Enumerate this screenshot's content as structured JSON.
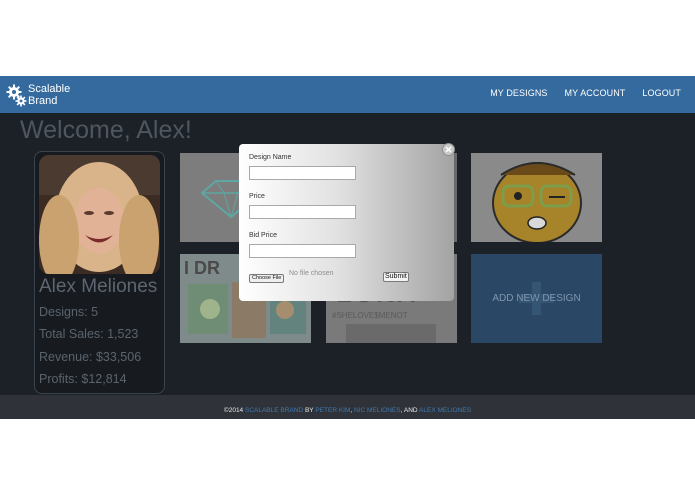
{
  "navbar": {
    "brand_line1": "Scalable",
    "brand_line2": "Brand",
    "links": [
      "MY DESIGNS",
      "MY ACCOUNT",
      "LOGOUT"
    ]
  },
  "main": {
    "welcome": "Welcome, Alex!",
    "profile": {
      "name": "Alex Meliones",
      "designs": "Designs: 5",
      "total_sales": "Total Sales: 1,523",
      "revenue": "Revenue: $33,506",
      "profits": "Profits: $12,814"
    },
    "add_new_design": "ADD NEW DESIGN"
  },
  "modal": {
    "design_name_label": "Design Name",
    "price_label": "Price",
    "bid_price_label": "Bid Price",
    "choose_file": "Choose File",
    "file_status": "No file chosen",
    "submit": "Submit"
  },
  "footer": {
    "copyright": "©2014",
    "brand_link": "SCALABLE BRAND",
    "by": "BY",
    "author1": "PETER KIM",
    "sep1": ",",
    "author2": "NIC MELIONES",
    "sep2": ", AND",
    "author3": "ALEX MELIONES"
  },
  "colors": {
    "navbar": "#356a9e",
    "main_bg": "#1c2127",
    "footer_bg": "#2f3339",
    "footer_link": "#3f78b0",
    "add_tile": "#2a4866"
  }
}
